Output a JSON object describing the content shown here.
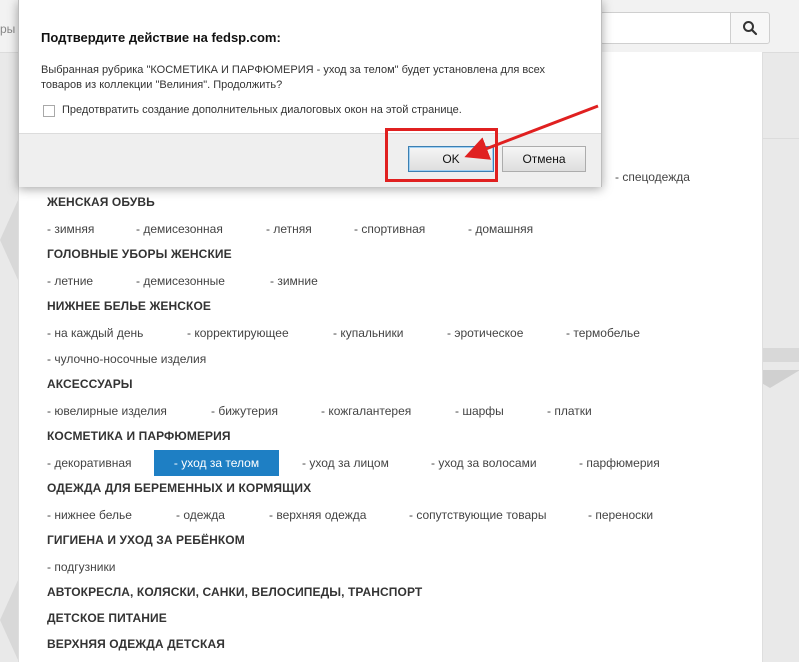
{
  "browser": {
    "left_stub_text": "ры",
    "search_icon": "search-icon"
  },
  "dialog": {
    "title": "Подтвердите действие на fedsp.com:",
    "message": "Выбранная рубрика \"КОСМЕТИКА И ПАРФЮМЕРИЯ - уход за телом\" будет установлена для всех товаров из коллекции \"Велиния\". Продолжить?",
    "checkbox_label": "Предотвратить создание дополнительных диалоговых окон на этой странице.",
    "ok_label": "OK",
    "cancel_label": "Отмена"
  },
  "catalog": {
    "spec_item": "- спецодежда",
    "categories": [
      {
        "title": "ЖЕНСКАЯ ОБУВЬ",
        "items": [
          "- зимняя",
          "- демисезонная",
          "- летняя",
          "- спортивная",
          "- домашняя"
        ]
      },
      {
        "title": "ГОЛОВНЫЕ УБОРЫ ЖЕНСКИЕ",
        "items": [
          "- летние",
          "- демисезонные",
          "- зимние"
        ]
      },
      {
        "title": "НИЖНЕЕ БЕЛЬЕ ЖЕНСКОЕ",
        "items": [
          "- на каждый день",
          "- корректирующее",
          "- купальники",
          "- эротическое",
          "- термобелье",
          "- чулочно-носочные изделия"
        ]
      },
      {
        "title": "АКСЕССУАРЫ",
        "items": [
          "- ювелирные изделия",
          "- бижутерия",
          "- кожгалантерея",
          "- шарфы",
          "- платки"
        ]
      },
      {
        "title": "КОСМЕТИКА И ПАРФЮМЕРИЯ",
        "items": [
          "- декоративная",
          "- уход за телом",
          "- уход за лицом",
          "- уход за волосами",
          "- парфюмерия"
        ]
      },
      {
        "title": "ОДЕЖДА ДЛЯ БЕРЕМЕННЫХ И КОРМЯЩИХ",
        "items": [
          "- нижнее белье",
          "- одежда",
          "- верхняя одежда",
          "- сопутствующие товары",
          "- переноски"
        ]
      },
      {
        "title": "ГИГИЕНА И УХОД ЗА РЕБЁНКОМ",
        "items": [
          "- подгузники"
        ]
      },
      {
        "title": "АВТОКРЕСЛА, КОЛЯСКИ, САНКИ, ВЕЛОСИПЕДЫ, ТРАНСПОРТ",
        "items": []
      },
      {
        "title": "ДЕТСКОЕ ПИТАНИЕ",
        "items": []
      },
      {
        "title": "ВЕРХНЯЯ ОДЕЖДА ДЕТСКАЯ",
        "items": []
      }
    ]
  },
  "colors": {
    "active_item_bg": "#1e7fc4",
    "annotation_red": "#e02020"
  }
}
